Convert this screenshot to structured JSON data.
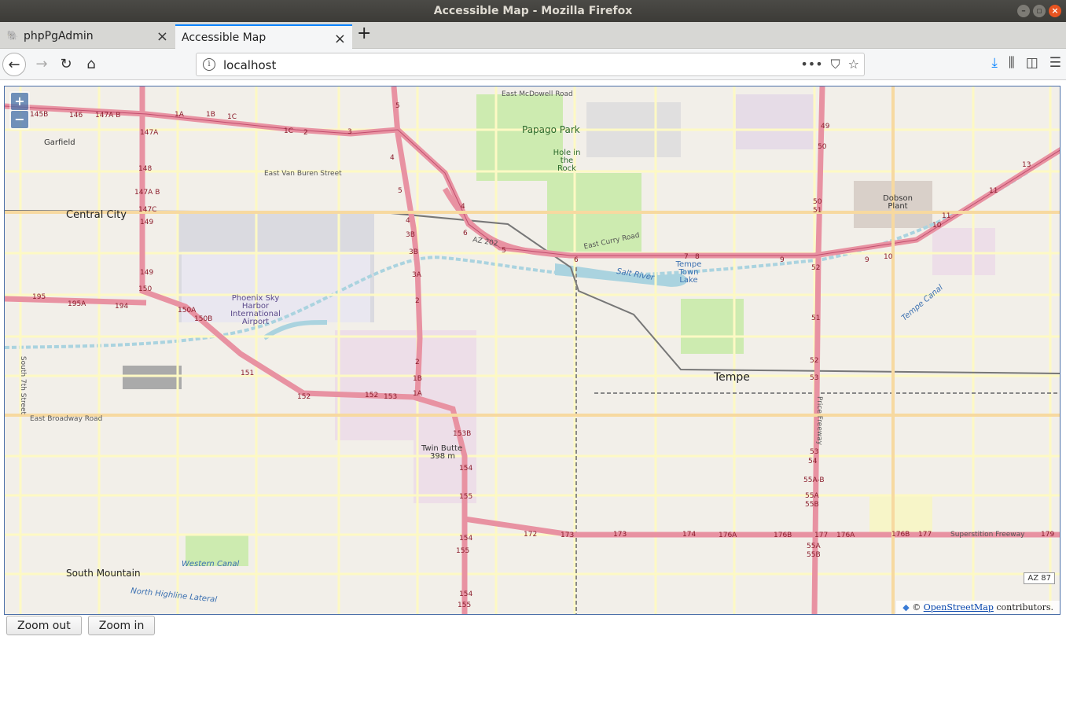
{
  "window": {
    "title": "Accessible Map - Mozilla Firefox"
  },
  "tabs": [
    {
      "label": "phpPgAdmin",
      "icon": "elephant-icon"
    },
    {
      "label": "Accessible Map",
      "icon": "none"
    }
  ],
  "navbar": {
    "url": "localhost"
  },
  "map": {
    "zoom_in_label": "+",
    "zoom_out_label": "−",
    "attribution_prefix": "©",
    "attribution_link": "OpenStreetMap",
    "attribution_suffix": "contributors.",
    "route_shield": "AZ 87",
    "places": {
      "central_city": "Central City",
      "garfield": "Garfield",
      "papago_park": "Papago Park",
      "hole_in_rock": "Hole in the Rock",
      "dobson_plant": "Dobson Plant",
      "tempe": "Tempe",
      "tempe_town_lake": "Tempe Town Lake",
      "airport": "Phoenix Sky Harbor International Airport",
      "twin_butte": "Twin Butte",
      "twin_butte_elev": "398 m",
      "south_mountain": "South Mountain"
    },
    "streets": {
      "east_mcdowell": "East McDowell Road",
      "east_van_buren": "East Van Buren Street",
      "east_curry": "East Curry Road",
      "east_broadway": "East Broadway Road",
      "south_7th": "South 7th Street",
      "price_freeway": "Price Freeway",
      "superstition": "Superstition Freeway",
      "az202": "AZ 202",
      "salt_river": "Salt River",
      "western_canal": "Western Canal",
      "highline_canal": "North Highline Lateral",
      "tempe_canal": "Tempe Canal"
    },
    "exits": [
      "145B",
      "146",
      "147A B",
      "1A",
      "1B",
      "1C",
      "1C",
      "2",
      "3",
      "147A",
      "148",
      "147A B",
      "147C",
      "149",
      "149",
      "150",
      "150A",
      "150B",
      "195",
      "195A",
      "194",
      "151",
      "152",
      "152",
      "153",
      "1A",
      "1B",
      "2",
      "2",
      "3A",
      "3B",
      "3B",
      "4",
      "4",
      "4",
      "5",
      "5",
      "5",
      "6",
      "6",
      "7",
      "8",
      "9",
      "9",
      "10",
      "10",
      "11",
      "11",
      "13",
      "49",
      "50",
      "50",
      "51",
      "51",
      "52",
      "52",
      "53",
      "53",
      "54",
      "55A-B",
      "55A",
      "55B",
      "55A",
      "55B",
      "153B",
      "154",
      "154",
      "155",
      "155",
      "154",
      "155",
      "172",
      "173",
      "173",
      "174",
      "176A",
      "176B",
      "177",
      "176A",
      "176B",
      "177",
      "179"
    ]
  },
  "buttons": {
    "zoom_out": "Zoom out",
    "zoom_in": "Zoom in"
  }
}
